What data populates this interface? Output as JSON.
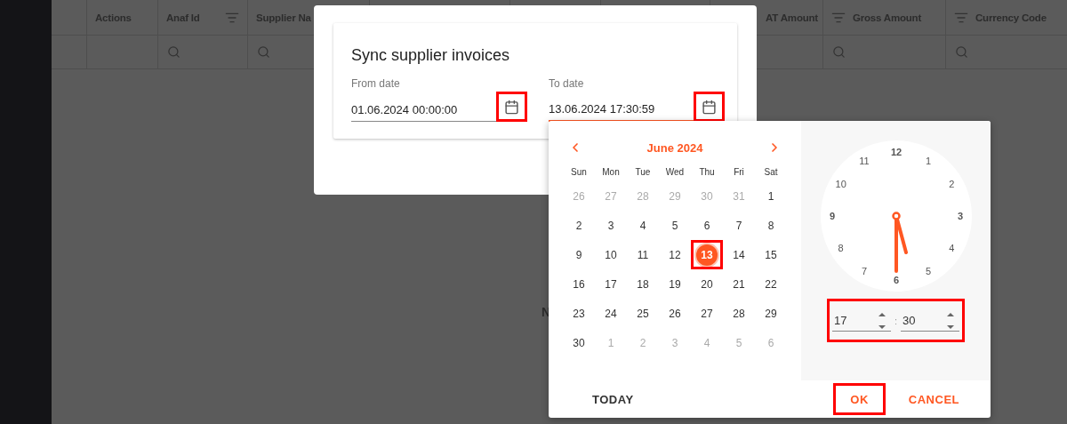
{
  "table": {
    "columns": [
      {
        "kind": "plain",
        "search": false
      },
      {
        "label": "Actions",
        "kind": "plain",
        "search": false
      },
      {
        "label": "Anaf Id",
        "kind": "filter-after",
        "search": true
      },
      {
        "label": "Supplier Na",
        "kind": "plain",
        "search": true
      },
      {
        "kind": "plain"
      },
      {
        "kind": "plain"
      },
      {
        "kind": "plain"
      },
      {
        "label": "AT Amount",
        "kind": "plain"
      },
      {
        "label": "Gross Amount",
        "kind": "filter-before",
        "search": true
      },
      {
        "label": "Currency Code",
        "kind": "filter-before",
        "search": true
      }
    ],
    "empty_message": "N"
  },
  "dialog": {
    "title": "Sync supplier invoices",
    "fields": [
      {
        "label": "From date",
        "value": "01.06.2024 00:00:00",
        "focused": false,
        "icon_highlighted": true
      },
      {
        "label": "To date",
        "value": "13.06.2024 17:30:59",
        "focused": true,
        "icon_highlighted": true
      }
    ]
  },
  "picker": {
    "month": "June 2024",
    "weekdays": [
      "Sun",
      "Mon",
      "Tue",
      "Wed",
      "Thu",
      "Fri",
      "Sat"
    ],
    "days": [
      {
        "label": "26",
        "outside": true,
        "selected": false,
        "highlighted": false
      },
      {
        "label": "27",
        "outside": true,
        "selected": false,
        "highlighted": false
      },
      {
        "label": "28",
        "outside": true,
        "selected": false,
        "highlighted": false
      },
      {
        "label": "29",
        "outside": true,
        "selected": false,
        "highlighted": false
      },
      {
        "label": "30",
        "outside": true,
        "selected": false,
        "highlighted": false
      },
      {
        "label": "31",
        "outside": true,
        "selected": false,
        "highlighted": false
      },
      {
        "label": "1",
        "outside": false,
        "selected": false,
        "highlighted": false
      },
      {
        "label": "2",
        "outside": false,
        "selected": false,
        "highlighted": false
      },
      {
        "label": "3",
        "outside": false,
        "selected": false,
        "highlighted": false
      },
      {
        "label": "4",
        "outside": false,
        "selected": false,
        "highlighted": false
      },
      {
        "label": "5",
        "outside": false,
        "selected": false,
        "highlighted": false
      },
      {
        "label": "6",
        "outside": false,
        "selected": false,
        "highlighted": false
      },
      {
        "label": "7",
        "outside": false,
        "selected": false,
        "highlighted": false
      },
      {
        "label": "8",
        "outside": false,
        "selected": false,
        "highlighted": false
      },
      {
        "label": "9",
        "outside": false,
        "selected": false,
        "highlighted": false
      },
      {
        "label": "10",
        "outside": false,
        "selected": false,
        "highlighted": false
      },
      {
        "label": "11",
        "outside": false,
        "selected": false,
        "highlighted": false
      },
      {
        "label": "12",
        "outside": false,
        "selected": false,
        "highlighted": false
      },
      {
        "label": "13",
        "outside": false,
        "selected": true,
        "highlighted": true
      },
      {
        "label": "14",
        "outside": false,
        "selected": false,
        "highlighted": false
      },
      {
        "label": "15",
        "outside": false,
        "selected": false,
        "highlighted": false
      },
      {
        "label": "16",
        "outside": false,
        "selected": false,
        "highlighted": false
      },
      {
        "label": "17",
        "outside": false,
        "selected": false,
        "highlighted": false
      },
      {
        "label": "18",
        "outside": false,
        "selected": false,
        "highlighted": false
      },
      {
        "label": "19",
        "outside": false,
        "selected": false,
        "highlighted": false
      },
      {
        "label": "20",
        "outside": false,
        "selected": false,
        "highlighted": false
      },
      {
        "label": "21",
        "outside": false,
        "selected": false,
        "highlighted": false
      },
      {
        "label": "22",
        "outside": false,
        "selected": false,
        "highlighted": false
      },
      {
        "label": "23",
        "outside": false,
        "selected": false,
        "highlighted": false
      },
      {
        "label": "24",
        "outside": false,
        "selected": false,
        "highlighted": false
      },
      {
        "label": "25",
        "outside": false,
        "selected": false,
        "highlighted": false
      },
      {
        "label": "26",
        "outside": false,
        "selected": false,
        "highlighted": false
      },
      {
        "label": "27",
        "outside": false,
        "selected": false,
        "highlighted": false
      },
      {
        "label": "28",
        "outside": false,
        "selected": false,
        "highlighted": false
      },
      {
        "label": "29",
        "outside": false,
        "selected": false,
        "highlighted": false
      },
      {
        "label": "30",
        "outside": false,
        "selected": false,
        "highlighted": false
      },
      {
        "label": "1",
        "outside": true,
        "selected": false,
        "highlighted": false
      },
      {
        "label": "2",
        "outside": true,
        "selected": false,
        "highlighted": false
      },
      {
        "label": "3",
        "outside": true,
        "selected": false,
        "highlighted": false
      },
      {
        "label": "4",
        "outside": true,
        "selected": false,
        "highlighted": false
      },
      {
        "label": "5",
        "outside": true,
        "selected": false,
        "highlighted": false
      },
      {
        "label": "6",
        "outside": true,
        "selected": false,
        "highlighted": false
      }
    ],
    "clock_numbers": [
      "12",
      "1",
      "2",
      "3",
      "4",
      "5",
      "6",
      "7",
      "8",
      "9",
      "10",
      "11"
    ],
    "time": {
      "hour": "17",
      "separator": ":",
      "minute": "30",
      "highlighted": true
    },
    "buttons": [
      {
        "label": "TODAY",
        "kind": "neutral",
        "highlighted": false
      },
      {
        "label": "OK",
        "kind": "accent",
        "highlighted": true
      },
      {
        "label": "CANCEL",
        "kind": "accent",
        "highlighted": false
      }
    ]
  }
}
